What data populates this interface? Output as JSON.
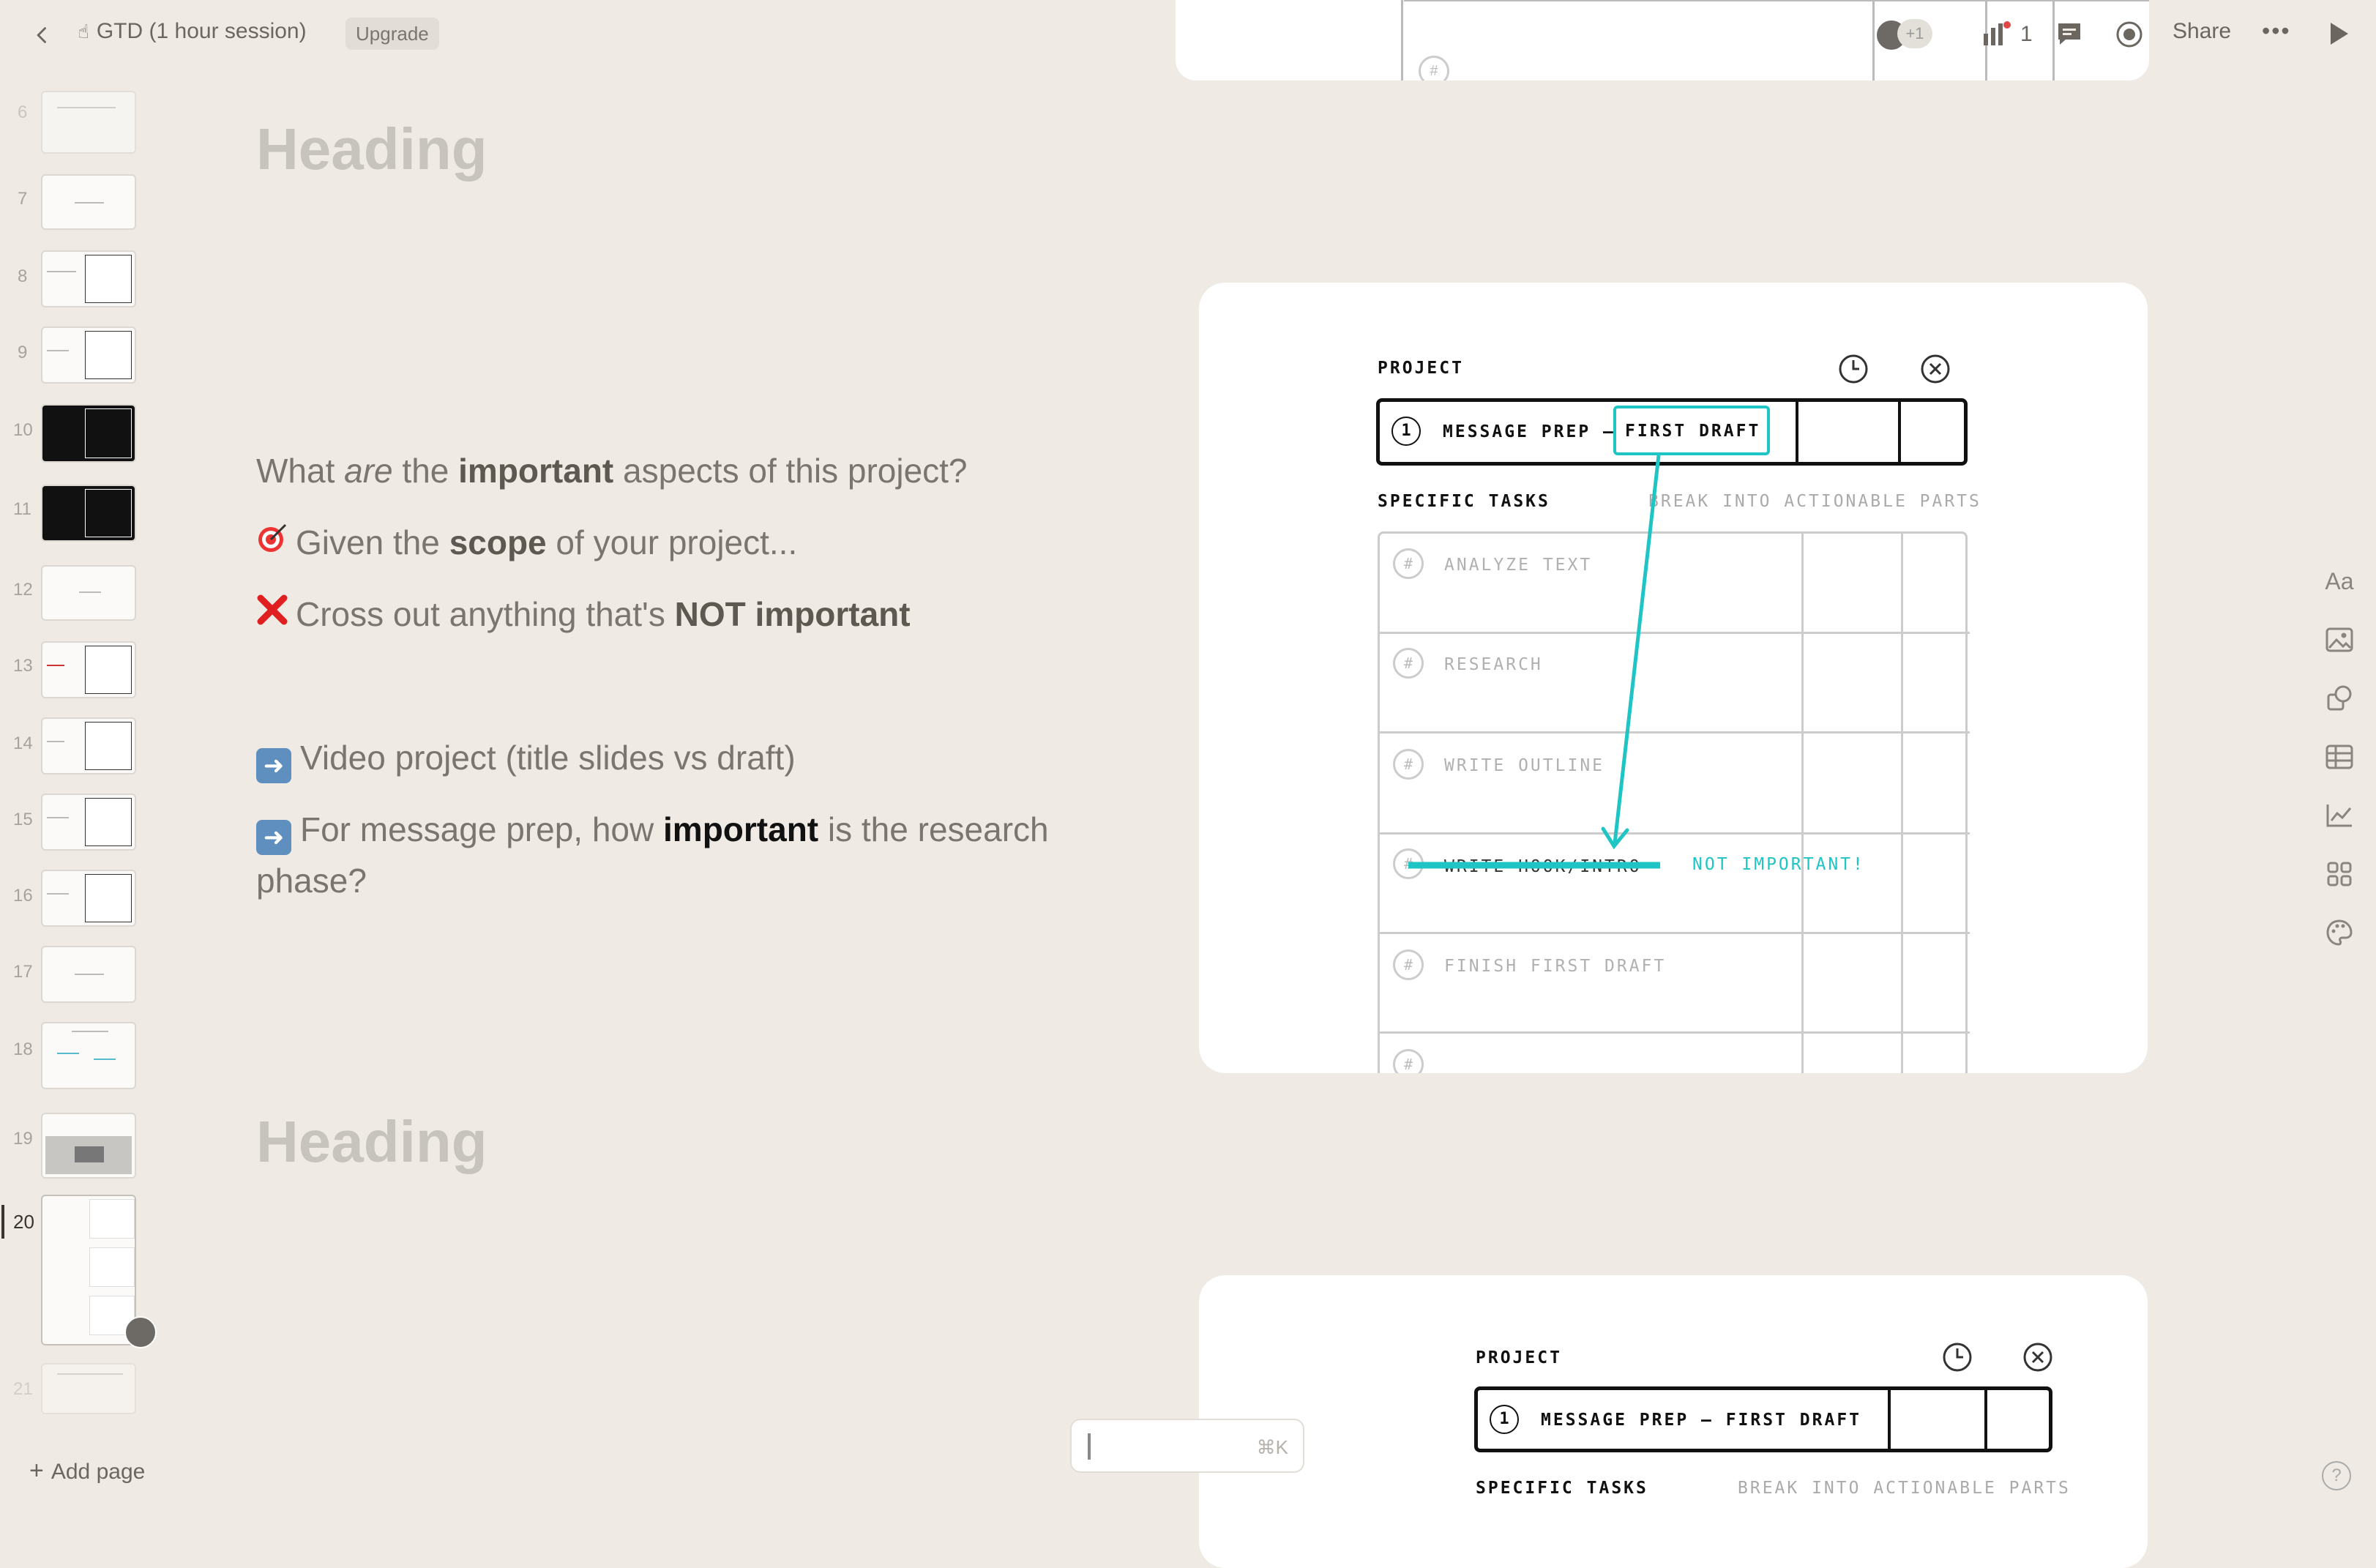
{
  "topbar": {
    "title": "GTD (1 hour session)",
    "title_icon": "pin-hand-icon",
    "upgrade": "Upgrade",
    "collab_count": "+1",
    "analytics_count": "1",
    "share": "Share",
    "more": "•••"
  },
  "sidebar": {
    "add_page": "Add page",
    "active_page": "20",
    "pages": [
      "6",
      "7",
      "8",
      "9",
      "10",
      "11",
      "12",
      "13",
      "14",
      "15",
      "16",
      "17",
      "18",
      "19",
      "20",
      "21"
    ]
  },
  "slides": {
    "heading_1": "Heading",
    "heading_2": "Heading",
    "line_1": {
      "pre": "What ",
      "em": "are",
      "mid": " the ",
      "bold": "important",
      "post": " aspects of this project?"
    },
    "line_2": {
      "pre": "Given the ",
      "bold": "scope",
      "post": " of your project..."
    },
    "line_3": {
      "pre": "Cross out anything that's ",
      "bold": "NOT important"
    },
    "line_4": {
      "text": "Video project (title slides vs draft)"
    },
    "line_5": {
      "pre": "For message prep, how ",
      "bold": "important",
      "post": " is the research",
      "line2": "phase?"
    }
  },
  "card_1": {
    "project_label": "PROJECT",
    "project_num": "1",
    "project_name": "MESSAGE PREP – ",
    "project_highlight": "FIRST DRAFT",
    "tasks_label": "SPECIFIC TASKS",
    "tasks_hint": "BREAK INTO ACTIONABLE PARTS",
    "hash": "#",
    "tasks": [
      "ANALYZE TEXT",
      "RESEARCH",
      "WRITE OUTLINE",
      "WRITE HOOK/INTRO",
      "FINISH FIRST DRAFT"
    ],
    "annotation": "NOT IMPORTANT!",
    "accent_color": "#1fc4c4"
  },
  "card_2": {
    "project_label": "PROJECT",
    "project_num": "1",
    "project_name": "MESSAGE PREP – FIRST DRAFT",
    "tasks_label": "SPECIFIC TASKS",
    "tasks_hint": "BREAK INTO ACTIONABLE PARTS"
  },
  "right_toolbar": {
    "text_style": "Aa"
  },
  "command": {
    "hint": "⌘K"
  },
  "help": "?"
}
